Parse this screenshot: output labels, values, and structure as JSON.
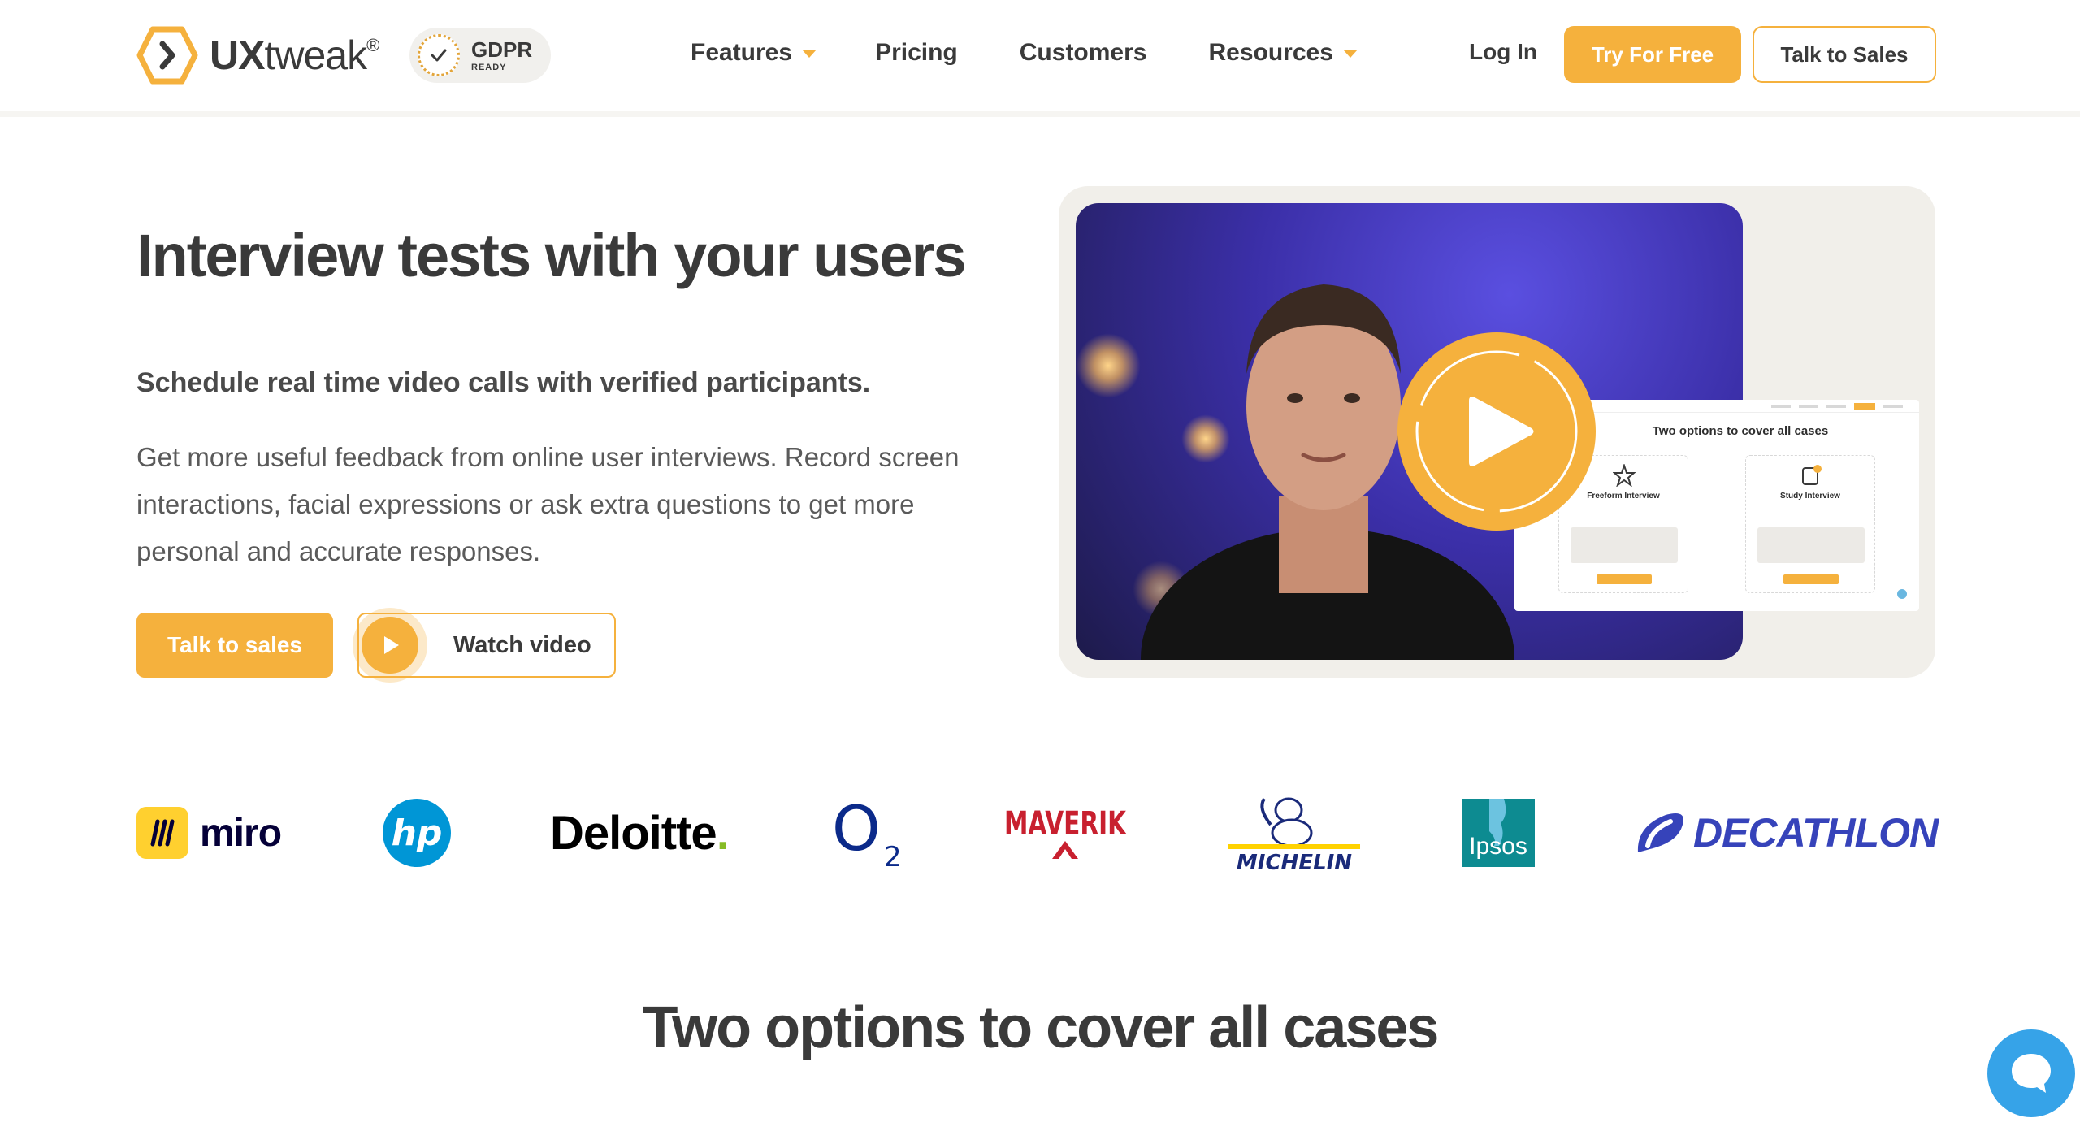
{
  "header": {
    "brand": {
      "name_bold": "UX",
      "name_rest": "tweak",
      "mark": "®"
    },
    "gdpr": {
      "title": "GDPR",
      "subtitle": "READY"
    },
    "nav": [
      {
        "label": "Features",
        "has_dropdown": true
      },
      {
        "label": "Pricing",
        "has_dropdown": false
      },
      {
        "label": "Customers",
        "has_dropdown": false
      },
      {
        "label": "Resources",
        "has_dropdown": true
      }
    ],
    "login_label": "Log In",
    "try_label": "Try For Free",
    "sales_label": "Talk to Sales"
  },
  "hero": {
    "title": "Interview tests with your users",
    "subtitle": "Schedule real time video calls with verified participants.",
    "body": "Get more useful feedback from online user interviews. Record screen interactions, facial expressions or ask extra questions to get more personal and accurate responses.",
    "primary_cta": "Talk to sales",
    "secondary_cta": "Watch video"
  },
  "video_preview": {
    "slide_title": "Two options to cover all cases",
    "option_a": "Freeform Interview",
    "option_b": "Study Interview"
  },
  "clients": {
    "miro": "miro",
    "hp": "hp",
    "deloitte": "Deloitte",
    "deloitte_dot": ".",
    "o2": "O",
    "o2_sub": "2",
    "maverik": "MAVERIK",
    "michelin": "MICHELIN",
    "ipsos": "Ipsos",
    "decathlon": "DECATHLON"
  },
  "section": {
    "title": "Two options to cover all cases"
  },
  "colors": {
    "accent": "#f5b13d",
    "text_dark": "#3a3a3a",
    "card_bg": "#f1efea",
    "chat_blue": "#36a3e8"
  },
  "icons": [
    "uxtweak-logo-icon",
    "gdpr-seal-icon",
    "chevron-down-icon",
    "play-icon",
    "chat-icon"
  ]
}
